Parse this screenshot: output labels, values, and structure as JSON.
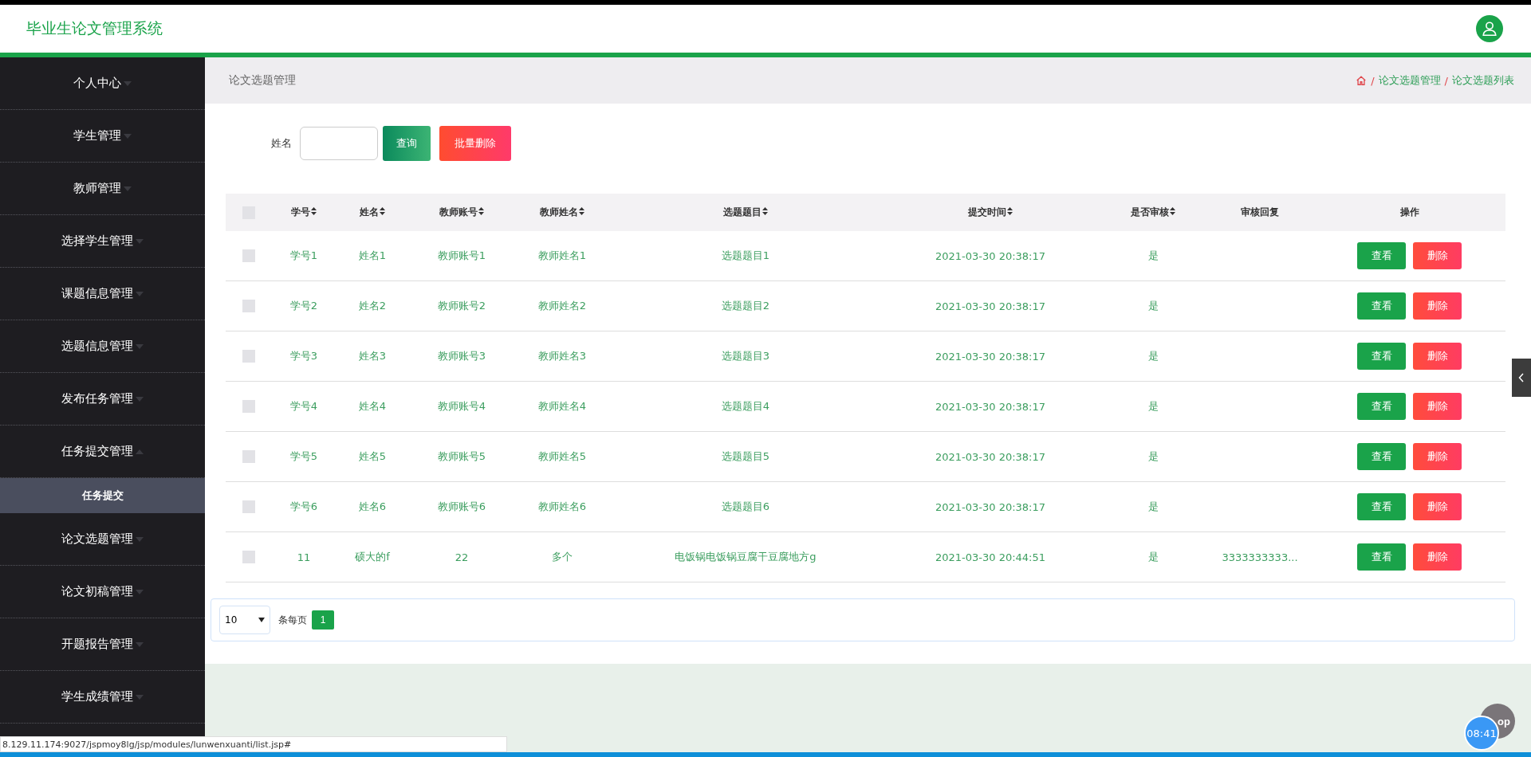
{
  "header": {
    "title": "毕业生论文管理系统"
  },
  "sidebar": {
    "items": [
      {
        "label": "个人中心",
        "expanded": false
      },
      {
        "label": "学生管理",
        "expanded": false
      },
      {
        "label": "教师管理",
        "expanded": false
      },
      {
        "label": "选择学生管理",
        "expanded": false
      },
      {
        "label": "课题信息管理",
        "expanded": false
      },
      {
        "label": "选题信息管理",
        "expanded": false
      },
      {
        "label": "发布任务管理",
        "expanded": false
      },
      {
        "label": "任务提交管理",
        "expanded": true,
        "children": [
          {
            "label": "任务提交"
          }
        ]
      },
      {
        "label": "论文选题管理",
        "expanded": false
      },
      {
        "label": "论文初稿管理",
        "expanded": false
      },
      {
        "label": "开题报告管理",
        "expanded": false
      },
      {
        "label": "学生成绩管理",
        "expanded": false
      }
    ]
  },
  "page_title": "论文选题管理",
  "breadcrumb": {
    "separator": "/",
    "items": [
      "论文选题管理",
      "论文选题列表"
    ]
  },
  "search": {
    "label": "姓名",
    "query_button": "查询",
    "batch_delete_button": "批量删除"
  },
  "table": {
    "columns": [
      {
        "label": "学号",
        "sortable": true
      },
      {
        "label": "姓名",
        "sortable": true
      },
      {
        "label": "教师账号",
        "sortable": true
      },
      {
        "label": "教师姓名",
        "sortable": true
      },
      {
        "label": "选题题目",
        "sortable": true
      },
      {
        "label": "提交时间",
        "sortable": true
      },
      {
        "label": "是否审核",
        "sortable": true
      },
      {
        "label": "审核回复",
        "sortable": false
      },
      {
        "label": "操作",
        "sortable": false
      }
    ],
    "header_checked": false,
    "rows": [
      {
        "checked": false,
        "cells": [
          "学号1",
          "姓名1",
          "教师账号1",
          "教师姓名1",
          "选题题目1",
          "2021-03-30 20:38:17",
          "是",
          ""
        ],
        "actions": [
          "查看",
          "删除"
        ]
      },
      {
        "checked": false,
        "cells": [
          "学号2",
          "姓名2",
          "教师账号2",
          "教师姓名2",
          "选题题目2",
          "2021-03-30 20:38:17",
          "是",
          ""
        ],
        "actions": [
          "查看",
          "删除"
        ]
      },
      {
        "checked": false,
        "cells": [
          "学号3",
          "姓名3",
          "教师账号3",
          "教师姓名3",
          "选题题目3",
          "2021-03-30 20:38:17",
          "是",
          ""
        ],
        "actions": [
          "查看",
          "删除"
        ]
      },
      {
        "checked": false,
        "cells": [
          "学号4",
          "姓名4",
          "教师账号4",
          "教师姓名4",
          "选题题目4",
          "2021-03-30 20:38:17",
          "是",
          ""
        ],
        "actions": [
          "查看",
          "删除"
        ]
      },
      {
        "checked": false,
        "cells": [
          "学号5",
          "姓名5",
          "教师账号5",
          "教师姓名5",
          "选题题目5",
          "2021-03-30 20:38:17",
          "是",
          ""
        ],
        "actions": [
          "查看",
          "删除"
        ]
      },
      {
        "checked": false,
        "cells": [
          "学号6",
          "姓名6",
          "教师账号6",
          "教师姓名6",
          "选题题目6",
          "2021-03-30 20:38:17",
          "是",
          ""
        ],
        "actions": [
          "查看",
          "删除"
        ]
      },
      {
        "checked": false,
        "cells": [
          "11",
          "硕大的f",
          "22",
          "多个",
          "电饭锅电饭锅豆腐干豆腐地方g",
          "2021-03-30 20:44:51",
          "是",
          "3333333333..."
        ],
        "actions": [
          "查看",
          "删除"
        ]
      }
    ]
  },
  "pagination": {
    "page_size": "10",
    "per_page_label": "条每页",
    "pages": [
      {
        "label": "1",
        "selected": true
      }
    ]
  },
  "top_button": "op",
  "timer": "08:41",
  "status_url": "8.129.11.174:9027/jspmoy8lg/jsp/modules/lunwenxuanti/list.jsp#"
}
